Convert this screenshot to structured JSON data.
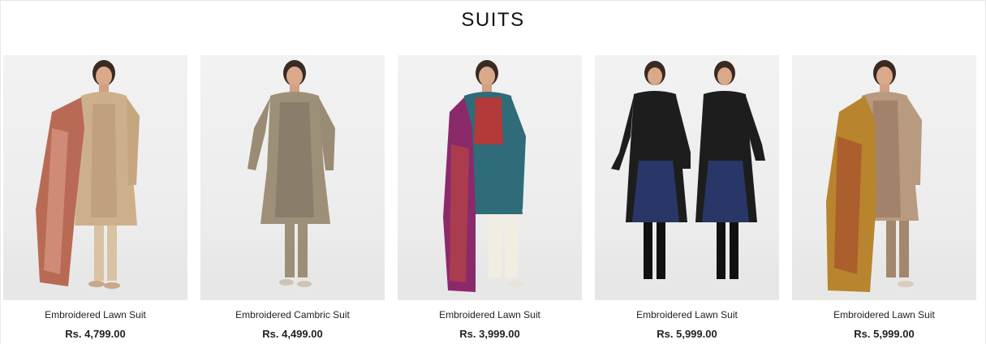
{
  "section": {
    "title": "SUITS"
  },
  "products": [
    {
      "name": "Embroidered Lawn Suit",
      "price": "Rs. 4,799.00"
    },
    {
      "name": "Embroidered Cambric Suit",
      "price": "Rs. 4,499.00"
    },
    {
      "name": "Embroidered Lawn Suit",
      "price": "Rs. 3,999.00"
    },
    {
      "name": "Embroidered Lawn Suit",
      "price": "Rs. 5,999.00"
    },
    {
      "name": "Embroidered Lawn Suit",
      "price": "Rs. 5,999.00"
    }
  ],
  "colors": {
    "background": "#ffffff",
    "photo_background": "#efefef",
    "text": "#222222"
  }
}
